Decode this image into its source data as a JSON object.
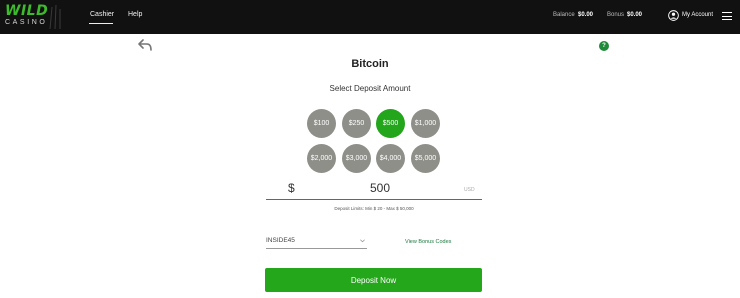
{
  "header": {
    "logo": {
      "word": "WILD",
      "sub": "CASINO"
    },
    "nav": [
      {
        "label": "Cashier"
      },
      {
        "label": "Help"
      }
    ],
    "balance_label": "Balance",
    "balance_value": "$0.00",
    "bonus_label": "Bonus",
    "bonus_value": "$0.00",
    "account_label": "My Account"
  },
  "page": {
    "title": "Bitcoin",
    "subtitle": "Select Deposit Amount",
    "help_badge": "?"
  },
  "amounts": [
    "$100",
    "$250",
    "$500",
    "$1,000",
    "$2,000",
    "$3,000",
    "$4,000",
    "$5,000"
  ],
  "selected_amount": "$500",
  "amount_field": {
    "currency_symbol": "$",
    "value": "500",
    "currency_code": "USD",
    "limits": "Deposit Limits: Min $ 20 - Max $ 50,000"
  },
  "promo": {
    "value": "INSIDE45",
    "link_label": "View Bonus Codes"
  },
  "deposit_button": "Deposit Now",
  "colors": {
    "topbar": "#111111",
    "brand_green": "#3dbb2c",
    "selected_green": "#23a51c",
    "button_green": "#25a71c",
    "amount_grey": "#8f8f8a"
  },
  "icons": {
    "back": "back-arrow-icon",
    "account": "user-circle-icon",
    "menu": "hamburger-menu-icon",
    "help": "question-icon",
    "caret": "chevron-down-icon"
  }
}
